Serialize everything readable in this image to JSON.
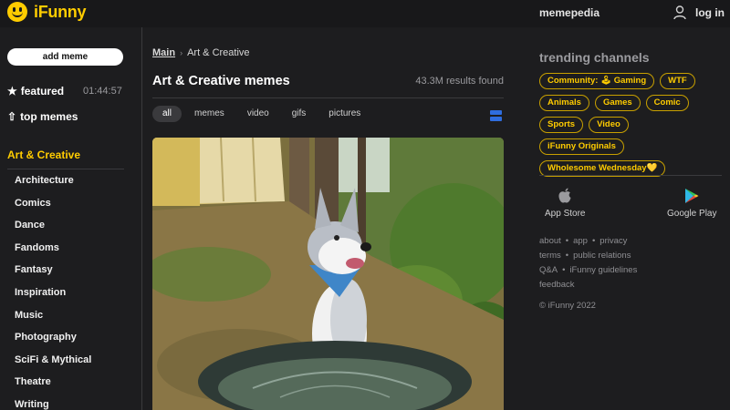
{
  "header": {
    "logo_text": "iFunny",
    "memepedia": "memepedia",
    "login": "log in"
  },
  "sidebar": {
    "add_meme": "add meme",
    "featured": "featured",
    "featured_timer": "01:44:57",
    "top_memes": "top memes",
    "category_heading": "Art & Creative",
    "categories": [
      "Architecture",
      "Comics",
      "Dance",
      "Fandoms",
      "Fantasy",
      "Inspiration",
      "Music",
      "Photography",
      "SciFi & Mythical",
      "Theatre",
      "Writing"
    ]
  },
  "main": {
    "breadcrumb": {
      "root": "Main",
      "current": "Art & Creative"
    },
    "title": "Art & Creative memes",
    "results": "43.3M results found",
    "filters": [
      "all",
      "memes",
      "video",
      "gifs",
      "pictures"
    ],
    "active_filter": "all"
  },
  "right": {
    "trending_title": "trending channels",
    "channels": [
      "Community: 🕹 Gaming",
      "WTF",
      "Animals",
      "Games",
      "Comic",
      "Sports",
      "Video",
      "iFunny Originals",
      "Wholesome Wednesday💛"
    ],
    "app_store": "App Store",
    "google_play": "Google Play",
    "links": {
      "about": "about",
      "app": "app",
      "privacy": "privacy",
      "terms": "terms",
      "public_relations": "public relations",
      "qa": "Q&A",
      "guidelines": "iFunny guidelines",
      "feedback": "feedback"
    },
    "copyright": "© iFunny 2022"
  },
  "colors": {
    "accent": "#ffcc00",
    "background": "#1d1d1f",
    "toggle_blue": "#2f6dde"
  }
}
